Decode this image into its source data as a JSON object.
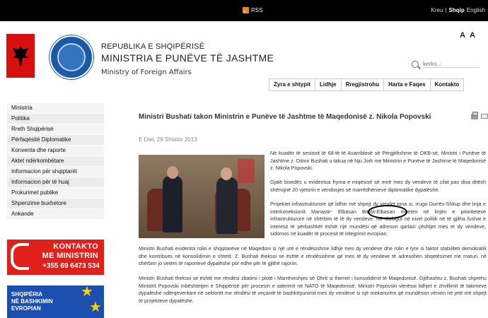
{
  "topbar": {
    "rss_label": "RSS",
    "home_label": "Kreu",
    "sep": "|",
    "lang_current": "Shqip",
    "lang_other": "English"
  },
  "header": {
    "line1": "REPUBLIKA E SHQIPËRISË",
    "line2": "MINISTRIA E PUNËVE TË JASHTME",
    "line3": "Ministry of Foreign Affairs",
    "font_small": "A",
    "font_large": "A"
  },
  "search": {
    "placeholder": "kerko..."
  },
  "mainnav": [
    "Zyra e shtypit",
    "Lidhje",
    "Rregjistrohu",
    "Harta e Faqes",
    "Kontakto"
  ],
  "sidebar": {
    "items": [
      "Ministria",
      "Politika",
      "Rreth Shqipërisë",
      "Përfaqësitë Diplomatike",
      "Konventa dhe raporte",
      "Aktet ndërkombëtare",
      "Informacion për shqiptarët",
      "Informacion për të huaj",
      "Prokurimet publike",
      "Shpenzime buxhetore",
      "Ankande"
    ]
  },
  "promo_contact": {
    "line1": "KONTAKTO",
    "line2": "ME MINISTRIN",
    "phone": "+355 69 6473 534"
  },
  "promo_eu": {
    "line1": "SHQIPËRIA",
    "line2": "NË BASHKIMIN",
    "line3": "EVROPIAN"
  },
  "article": {
    "title": "Ministri Bushati takon Ministrin e Punëve të Jashtme të Maqedonisë z. Nikola Popovski",
    "date": "E Diel, 29 Shtator 2013",
    "p1": "Në kuadër të sesionit të 68-të të Asamblesë së Përgjithshme të OKB-së, Ministri i Punëve të Jashtme z. Ditmir Bushati u takua në Nju Jork me Ministrin e Punëve të Jashtme të Maqedonisë z. Nikola Popovski.",
    "p2": "Gjatë bisedës u evidentua fryma e miqësisë së mirë mes dy vendeve të cilat pas disa ditësh shënojnë 20 vjetorin e vendosjes së marrëdhënieve diplomatike dypalëshe.",
    "p3": "Projektet infrastrukturore që lidhin më shpejt dy vendet tona si, rruga Durrës-Shkup dhe linja e interkoneksionit Manastir- Elbasan Bitola-Elbasan mbeten në linjën e prioriteteve infrastrukturore në shërbim të të dy vendeve. Në dialogut në nivel politik në të gjitha fushat e interesit të përbashkët është një mundësi që adreson qartazi çështjet mes të dy vendeve, sidomos në kuadër të procesit të integrimit evropian.",
    "p4": "Ministri Bushati evidentoi rolin e shqiptarëve në Maqedoni si një urë e rëndësishme lidhje mes dy vendeve dhe rolin e tyre si faktor stabiliteti demokratik dhe kontribues në konsolidimin e shtetit. Z. Bushati theksoi se është e rëndësishme që mes të dy vendeve të adresohen shqetësimet me maturi, në shërbim jo vetëm të raporteve dypalëshe por edhe për të gjithë rajonin.",
    "p5": "Ministri Bushati theksoi se është me rëndësi zbatimi i plotë i Marrëveshjes së Ohrit si themel i konsolidimit të Maqedonisë. Gjithashtu z. Bushati shprehu Ministrit Popovski mbështetjen e Shqipërisë për procesin e aderimit në NATO të Maqedonisë. Ministri Popovski vlerësoi lidhjet e zhvillimit të takimeve dypalëshe ndërqeveritare në sektorët me rëndësi të veçantë të bashkëpunimit mes dy vendeve si një mekanizëm që mundëson vënien në jetë më shpejt të projekteve dypalëshe."
  },
  "colors": {
    "topbar": "#000000",
    "promo_red": "#e0211b",
    "promo_blue": "#1c4fb0",
    "star": "#f5d200"
  }
}
